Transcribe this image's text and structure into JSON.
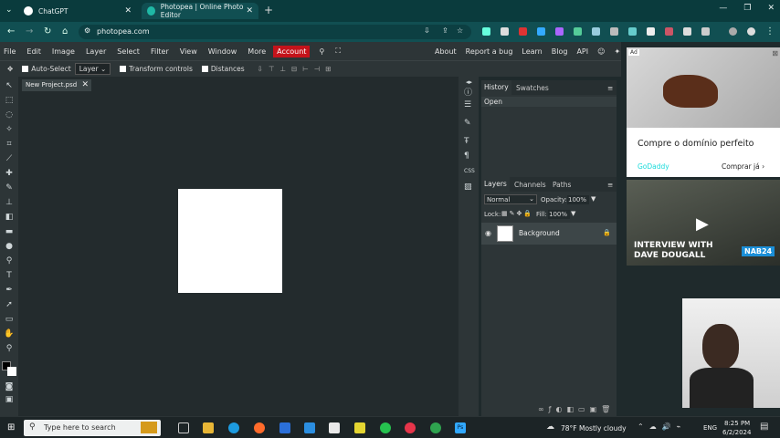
{
  "browser": {
    "tabs": [
      {
        "label": "ChatGPT"
      },
      {
        "label": "Photopea | Online Photo Editor"
      }
    ],
    "url": "photopea.com"
  },
  "menu": {
    "items": [
      "File",
      "Edit",
      "Image",
      "Layer",
      "Select",
      "Filter",
      "View",
      "Window",
      "More"
    ],
    "account": "Account",
    "right_links": [
      "About",
      "Report a bug",
      "Learn",
      "Blog",
      "API"
    ]
  },
  "options": {
    "auto_select": "Auto-Select",
    "layer_select": "Layer",
    "transform": "Transform controls",
    "distances": "Distances"
  },
  "document": {
    "tab_title": "New Project.psd"
  },
  "history_panel": {
    "tabs": [
      "History",
      "Swatches"
    ],
    "entries": [
      "Open"
    ]
  },
  "layers_panel": {
    "tabs": [
      "Layers",
      "Channels",
      "Paths"
    ],
    "blend_mode": "Normal",
    "opacity_label": "Opacity:",
    "opacity_value": "100%",
    "lock_label": "Lock:",
    "fill_label": "Fill:",
    "fill_value": "100%",
    "layers": [
      {
        "name": "Background"
      }
    ]
  },
  "ads": {
    "ad1_title": "Compre o domínio perfeito",
    "ad1_brand": "GoDaddy",
    "ad1_cta": "Comprar já",
    "ad2_line1": "INTERVIEW WITH",
    "ad2_line2": "DAVE DOUGALL",
    "ad2_badge": "NAB24"
  },
  "taskbar": {
    "search_placeholder": "Type here to search",
    "weather": "78°F  Mostly cloudy",
    "language": "ENG",
    "time": "8:25 PM",
    "date": "6/2/2024"
  }
}
